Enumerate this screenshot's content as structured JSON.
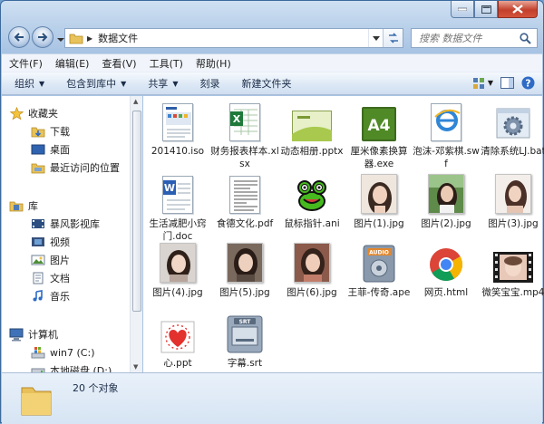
{
  "window": {
    "address_path": "数据文件",
    "search_placeholder": "搜索 数据文件"
  },
  "menu": [
    "文件(F)",
    "编辑(E)",
    "查看(V)",
    "工具(T)",
    "帮助(H)"
  ],
  "toolbar": {
    "organize": "组织",
    "include_in_library": "包含到库中",
    "share": "共享",
    "burn": "刻录",
    "new_folder": "新建文件夹"
  },
  "nav": {
    "favorites": "收藏夹",
    "downloads": "下载",
    "desktop": "桌面",
    "recent": "最近访问的位置",
    "libraries": "库",
    "storm_video": "暴风影视库",
    "videos": "视频",
    "pictures": "图片",
    "documents": "文档",
    "music": "音乐",
    "computer": "计算机",
    "drive_c": "win7 (C:)",
    "drive_d": "本地磁盘 (D:)"
  },
  "files": [
    {
      "name": "201410.iso",
      "icon": "iso-file-icon"
    },
    {
      "name": "财务报表样本.xlsx",
      "icon": "excel-file-icon"
    },
    {
      "name": "动态相册.pptx",
      "icon": "powerpoint-file-icon"
    },
    {
      "name": "厘米像素换算器.exe",
      "icon": "a4-exe-icon"
    },
    {
      "name": "泡沫-邓紫棋.swf",
      "icon": "ie-swf-icon"
    },
    {
      "name": "清除系统LJ.bat",
      "icon": "gear-bat-icon"
    },
    {
      "name": "生活减肥小窍门.doc",
      "icon": "word-file-icon"
    },
    {
      "name": "食德文化.pdf",
      "icon": "pdf-file-icon"
    },
    {
      "name": "鼠标指针.ani",
      "icon": "frog-cursor-icon"
    },
    {
      "name": "图片(1).jpg",
      "icon": "photo-icon"
    },
    {
      "name": "图片(2).jpg",
      "icon": "photo-icon"
    },
    {
      "name": "图片(3).jpg",
      "icon": "photo-icon"
    },
    {
      "name": "图片(4).jpg",
      "icon": "photo-icon"
    },
    {
      "name": "图片(5).jpg",
      "icon": "photo-icon"
    },
    {
      "name": "图片(6).jpg",
      "icon": "photo-icon"
    },
    {
      "name": "王菲-传奇.ape",
      "icon": "audio-file-icon"
    },
    {
      "name": "网页.html",
      "icon": "chrome-icon"
    },
    {
      "name": "微笑宝宝.mp4",
      "icon": "video-file-icon"
    },
    {
      "name": "心.ppt",
      "icon": "heart-ppt-icon"
    },
    {
      "name": "字幕.srt",
      "icon": "srt-file-icon"
    }
  ],
  "status": {
    "count_text": "20 个对象"
  }
}
